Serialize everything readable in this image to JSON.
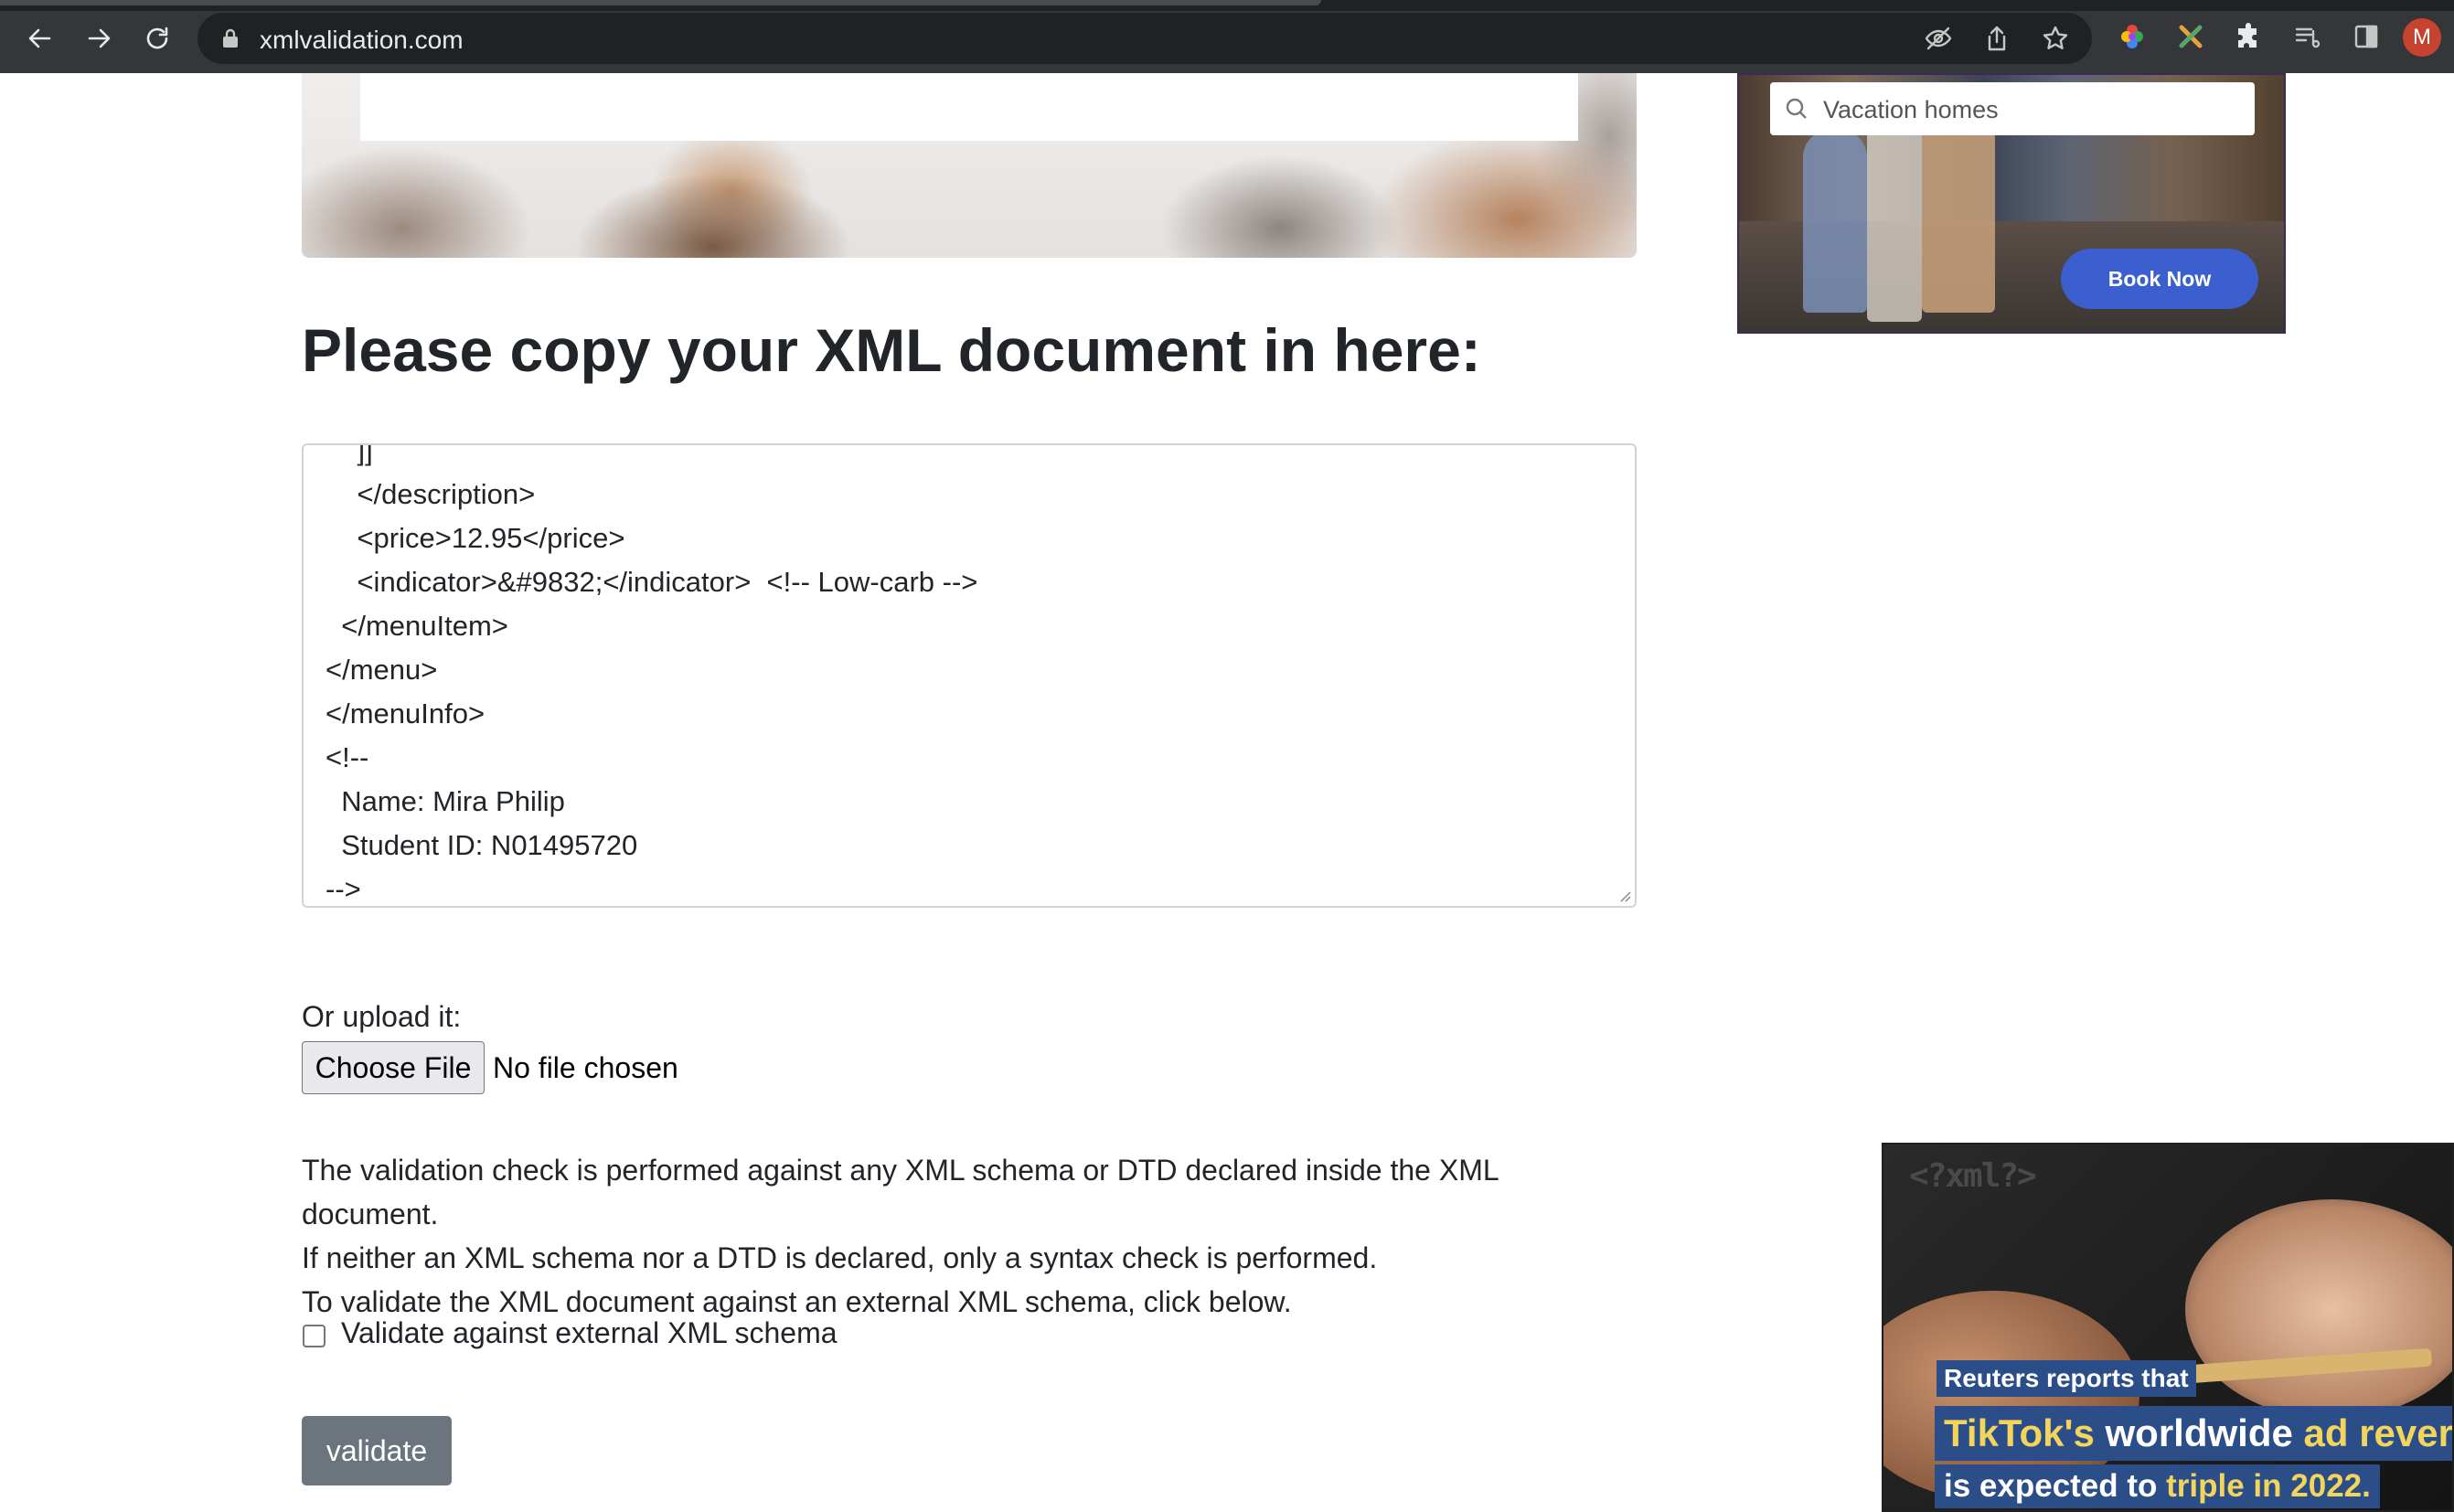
{
  "browser": {
    "url": "xmlvalidation.com",
    "profile_initial": "M",
    "icons": [
      "back-icon",
      "forward-icon",
      "reload-icon",
      "lock-icon",
      "eye-off-icon",
      "share-icon",
      "star-icon",
      "color-wheel-icon",
      "x-extension-icon",
      "puzzle-icon",
      "reading-list-icon",
      "side-panel-icon"
    ]
  },
  "ad_top": {
    "search_placeholder": "Vacation homes",
    "book_label": "Book Now"
  },
  "main": {
    "heading": "Please copy your XML document in here:",
    "xml_text": "    ]]\n    </description>\n    <price>12.95</price>\n    <indicator>&#9832;</indicator>  <!-- Low-carb -->\n  </menuItem>\n</menu>\n</menuInfo>\n<!--\n  Name: Mira Philip\n  Student ID: N01495720\n-->",
    "upload_label": "Or upload it:",
    "choose_file_label": "Choose File",
    "no_file_text": "No file chosen",
    "info_line1": "The validation check is performed against any XML schema or DTD declared inside the XML",
    "info_line2": "document.",
    "info_line3": "If neither an XML schema nor a DTD is declared, only a syntax check is performed.",
    "info_line4": "To validate the XML document against an external XML schema, click below.",
    "checkbox_label": "Validate against external XML schema",
    "checkbox_checked": false,
    "validate_label": "validate"
  },
  "video_ad": {
    "tag": "<?xml?>",
    "caption1": "Reuters reports that",
    "caption2_part1": "TikTok's",
    "caption2_part2": " worldwide ",
    "caption2_part3": "ad rever",
    "caption3_part1": "is expected to ",
    "caption3_part2": "triple in 2022."
  },
  "colors": {
    "chrome_bg": "#35363a",
    "omnibox_bg": "#202124",
    "validate_btn": "#6c757d",
    "book_btn": "#3b5fcf",
    "caption_bg": "#2b4e88",
    "caption_accent": "#f3d45c"
  }
}
